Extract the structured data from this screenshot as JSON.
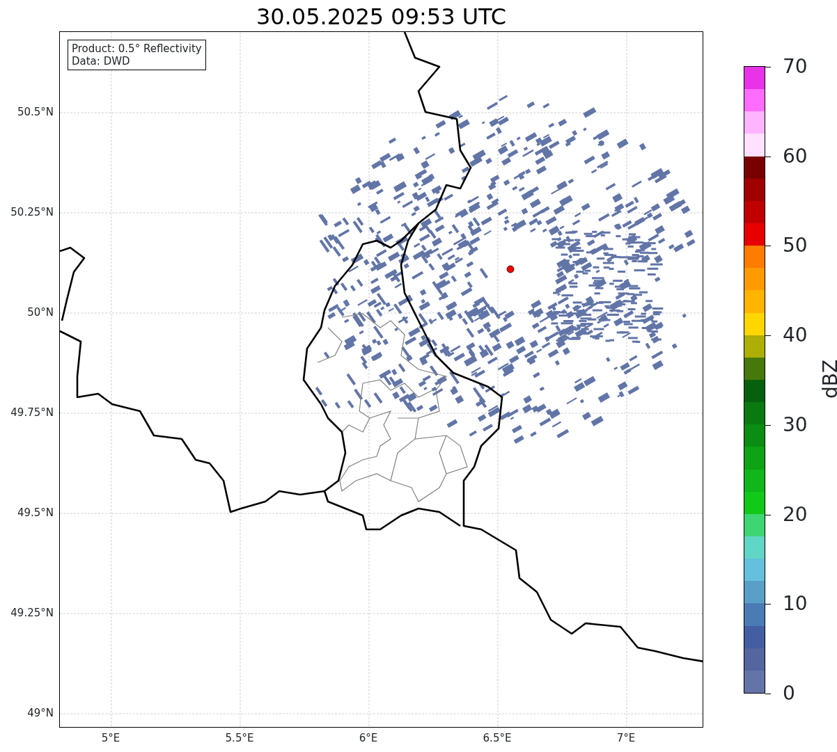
{
  "title": "30.05.2025 09:53 UTC",
  "info_box": [
    "Product: 0.5° Reflectivity",
    "Data: DWD"
  ],
  "map": {
    "lat_labels": [
      "50.5°N",
      "50.25°N",
      "50°N",
      "49.75°N",
      "49.5°N",
      "49.25°N",
      "49°N"
    ],
    "lon_labels": [
      "5°E",
      "5.5°E",
      "6°E",
      "6.5°E",
      "7°E"
    ]
  },
  "colorbar": {
    "label": "dBZ",
    "ticks": [
      "70",
      "60",
      "50",
      "40",
      "30",
      "20",
      "10",
      "0"
    ],
    "bands": [
      {
        "color": "#e833e8"
      },
      {
        "color": "#ff6cff"
      },
      {
        "color": "#ffb4ff"
      },
      {
        "color": "#ffe0ff"
      },
      {
        "color": "#780000"
      },
      {
        "color": "#a00000"
      },
      {
        "color": "#c00000"
      },
      {
        "color": "#e60000"
      },
      {
        "color": "#ff7c00"
      },
      {
        "color": "#ff9a00"
      },
      {
        "color": "#ffb400"
      },
      {
        "color": "#ffd600"
      },
      {
        "color": "#adae06"
      },
      {
        "color": "#47780c"
      },
      {
        "color": "#06600e"
      },
      {
        "color": "#0a7a10"
      },
      {
        "color": "#0b8c12"
      },
      {
        "color": "#0ea314"
      },
      {
        "color": "#10b61a"
      },
      {
        "color": "#12c91a"
      },
      {
        "color": "#3dd672"
      },
      {
        "color": "#60d6c6"
      },
      {
        "color": "#64c0dc"
      },
      {
        "color": "#5a9fc8"
      },
      {
        "color": "#4a7bb4"
      },
      {
        "color": "#435ea3"
      },
      {
        "color": "#5466a0"
      },
      {
        "color": "#6474a8"
      }
    ]
  }
}
